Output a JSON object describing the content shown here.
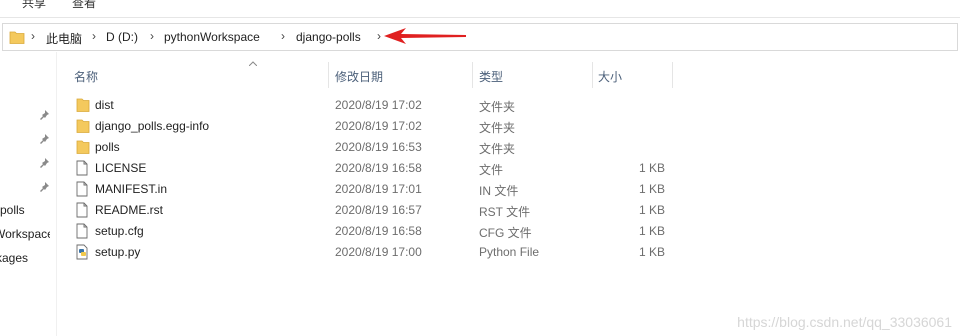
{
  "ribbon": {
    "tabs": [
      "共享",
      "查看"
    ]
  },
  "address": {
    "crumbs": [
      "此电脑",
      "D (D:)",
      "pythonWorkspace",
      "django-polls"
    ]
  },
  "nav": {
    "items": [
      "polls",
      "Workspace",
      "kages"
    ]
  },
  "columns": {
    "name": "名称",
    "date": "修改日期",
    "type": "类型",
    "size": "大小"
  },
  "files": [
    {
      "name": "dist",
      "date": "2020/8/19 17:02",
      "type": "文件夹",
      "size": "",
      "icon": "folder-icon"
    },
    {
      "name": "django_polls.egg-info",
      "date": "2020/8/19 17:02",
      "type": "文件夹",
      "size": "",
      "icon": "folder-icon"
    },
    {
      "name": "polls",
      "date": "2020/8/19 16:53",
      "type": "文件夹",
      "size": "",
      "icon": "folder-icon"
    },
    {
      "name": "LICENSE",
      "date": "2020/8/19 16:58",
      "type": "文件",
      "size": "1 KB",
      "icon": "file-icon"
    },
    {
      "name": "MANIFEST.in",
      "date": "2020/8/19 17:01",
      "type": "IN 文件",
      "size": "1 KB",
      "icon": "file-icon"
    },
    {
      "name": "README.rst",
      "date": "2020/8/19 16:57",
      "type": "RST 文件",
      "size": "1 KB",
      "icon": "file-icon"
    },
    {
      "name": "setup.cfg",
      "date": "2020/8/19 16:58",
      "type": "CFG 文件",
      "size": "1 KB",
      "icon": "file-icon"
    },
    {
      "name": "setup.py",
      "date": "2020/8/19 17:00",
      "type": "Python File",
      "size": "1 KB",
      "icon": "python-file-icon"
    }
  ],
  "watermark": "https://blog.csdn.net/qq_33036061",
  "colors": {
    "folder": "#f4c95d",
    "arrow": "#e02020",
    "header_text": "#4c607a"
  }
}
